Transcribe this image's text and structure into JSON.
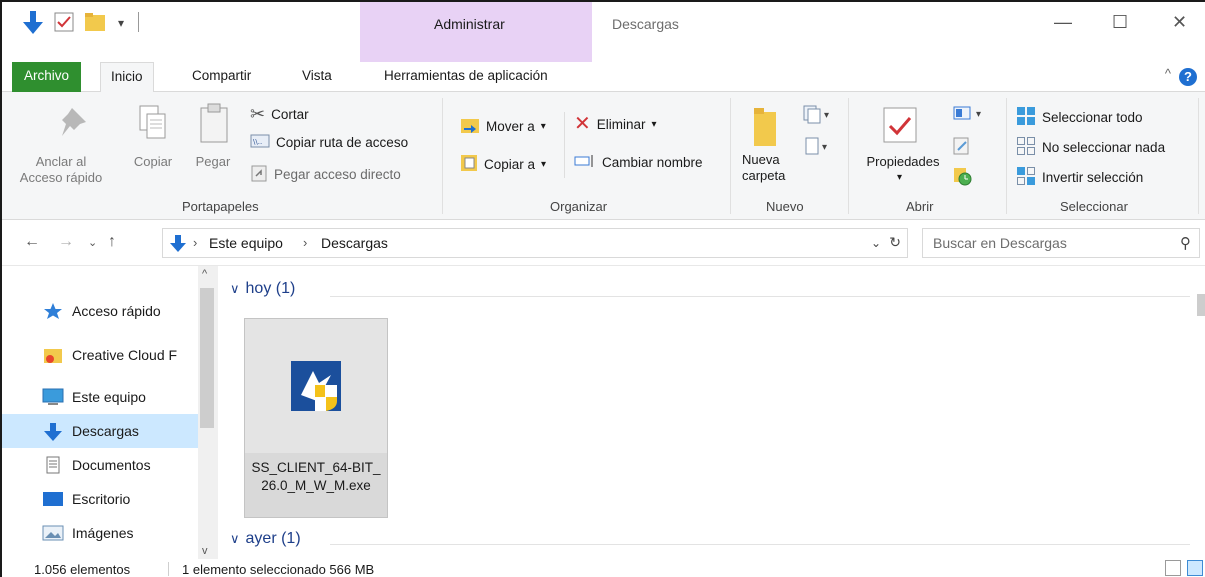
{
  "titlebar": {
    "contextual_group": "Administrar",
    "window_title": "Descargas",
    "controls": {
      "minimize": "—",
      "maximize": "☐",
      "close": "✕"
    },
    "quick_access_icons": [
      "download-icon",
      "properties-checkbox-icon",
      "new-folder-icon",
      "customize-qa-dropdown-icon"
    ]
  },
  "tabs": {
    "file": "Archivo",
    "home": "Inicio",
    "share": "Compartir",
    "view": "Vista",
    "tools": "Herramientas de aplicación",
    "collapse": "^",
    "help": "?"
  },
  "ribbon": {
    "portapapeles": {
      "label": "Portapapeles",
      "pin": "Anclar al\nAcceso rápido",
      "copy": "Copiar",
      "paste": "Pegar",
      "cut": "Cortar",
      "copy_path": "Copiar ruta de acceso",
      "paste_shortcut": "Pegar acceso directo"
    },
    "organizar": {
      "label": "Organizar",
      "move_to": "Mover a",
      "copy_to": "Copiar a",
      "delete": "Eliminar",
      "rename": "Cambiar nombre"
    },
    "nuevo": {
      "label": "Nuevo",
      "new_folder": "Nueva\ncarpeta"
    },
    "abrir": {
      "label": "Abrir",
      "properties": "Propiedades"
    },
    "seleccionar": {
      "label": "Seleccionar",
      "select_all": "Seleccionar todo",
      "select_none": "No seleccionar nada",
      "invert": "Invertir selección"
    }
  },
  "address": {
    "breadcrumbs": [
      "Este equipo",
      "Descargas"
    ],
    "search_placeholder": "Buscar en Descargas"
  },
  "navpane": {
    "items": [
      {
        "label": "Acceso rápido",
        "icon": "star-icon"
      },
      {
        "label": "Creative Cloud F",
        "icon": "creative-cloud-folder-icon"
      },
      {
        "label": "Este equipo",
        "icon": "computer-icon"
      },
      {
        "label": "Descargas",
        "icon": "download-arrow-icon",
        "selected": true
      },
      {
        "label": "Documentos",
        "icon": "documents-icon"
      },
      {
        "label": "Escritorio",
        "icon": "desktop-icon"
      },
      {
        "label": "Imágenes",
        "icon": "pictures-icon"
      }
    ]
  },
  "content": {
    "groups": [
      {
        "label": "hoy (1)"
      },
      {
        "label": "ayer (1)"
      }
    ],
    "file": {
      "name": "SS_CLIENT_64-BIT_26.0_M_W_M.exe",
      "icon": "installer-shield-icon"
    }
  },
  "status": {
    "count": "1.056 elementos",
    "selection": "1 elemento seleccionado  566 MB"
  },
  "colors": {
    "file_tab": "#2f8f2f",
    "contextual": "#e8d2f5",
    "selection": "#cce8ff",
    "group_header": "#1e3f8a"
  }
}
